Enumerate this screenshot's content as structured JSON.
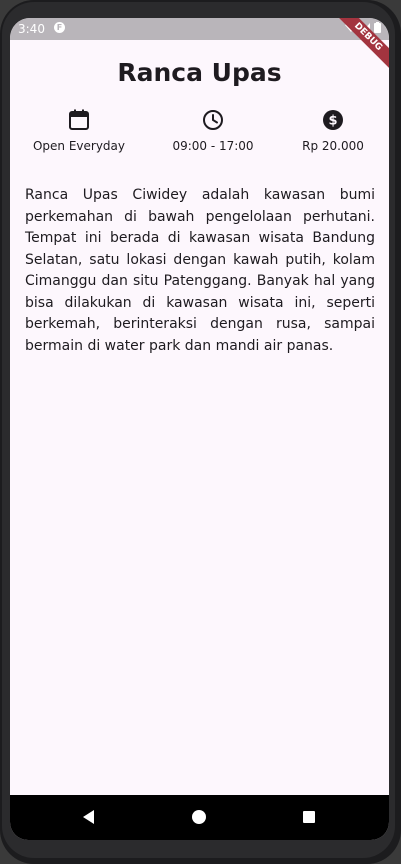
{
  "status_bar": {
    "time": "3:40",
    "app_icon": "notification-app-icon"
  },
  "debug_banner": "DEBUG",
  "page": {
    "title": "Ranca Upas"
  },
  "info": [
    {
      "icon": "calendar-icon",
      "label": "Open Everyday"
    },
    {
      "icon": "clock-icon",
      "label": "09:00 - 17:00"
    },
    {
      "icon": "money-icon",
      "label": "Rp 20.000"
    }
  ],
  "description": "Ranca Upas Ciwidey adalah kawasan bumi perkemahan di bawah pengelolaan perhutani. Tempat ini berada di kawasan wisata Bandung Selatan, satu lokasi dengan kawah putih, kolam Cimanggu dan situ Patenggang. Banyak hal yang bisa dilakukan di kawasan wisata ini, seperti berkemah, berinteraksi dengan rusa, sampai bermain di water park dan mandi air panas.",
  "nav": {
    "back_icon": "back-triangle-icon",
    "home_icon": "home-circle-icon",
    "recents_icon": "recents-square-icon"
  }
}
